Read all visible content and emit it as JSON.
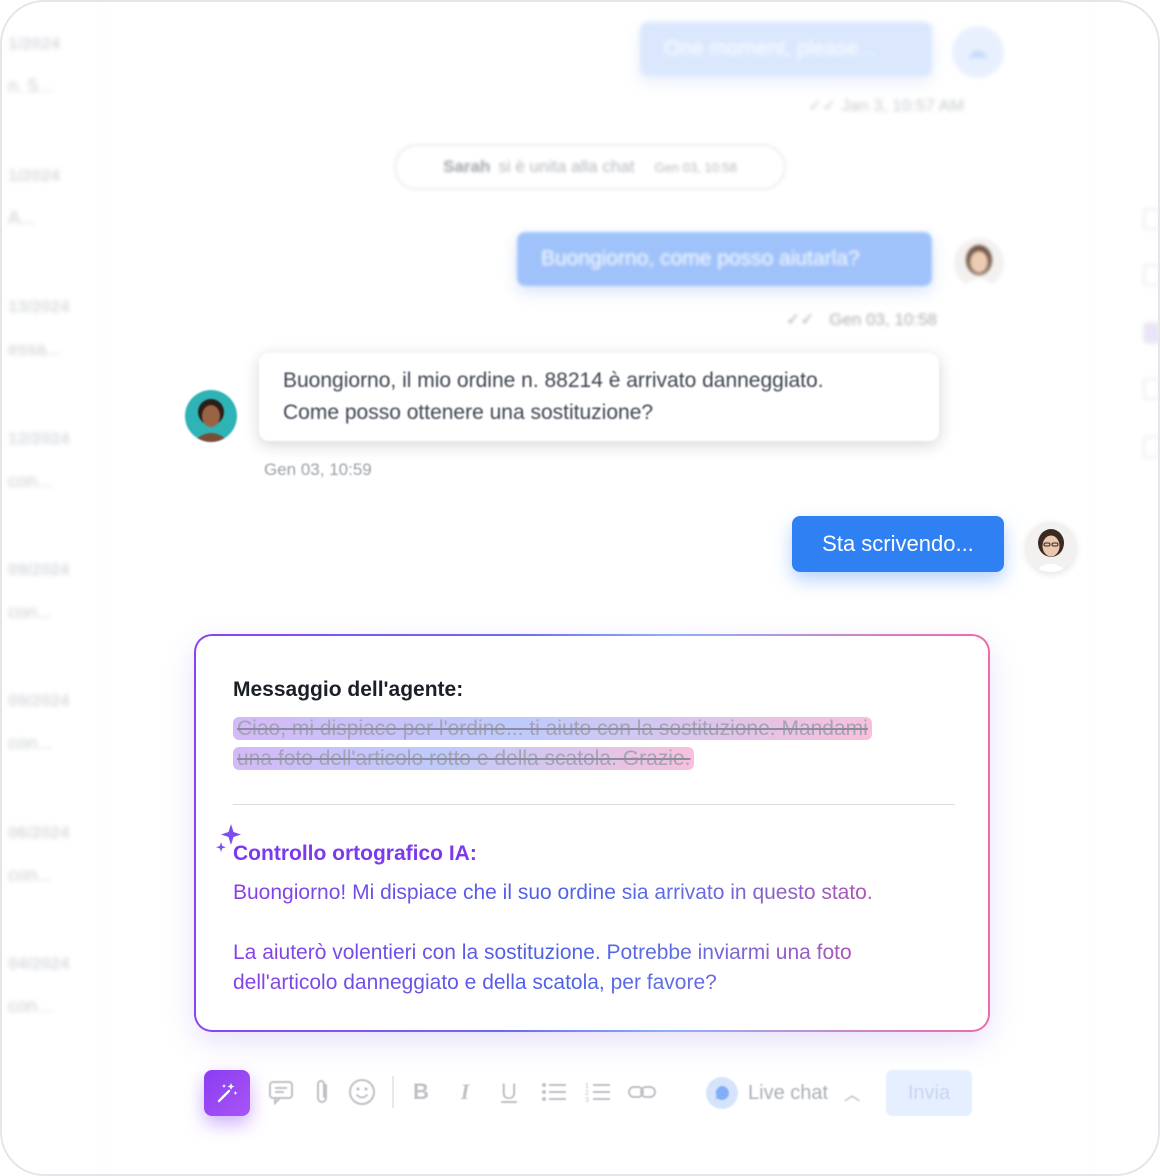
{
  "sidebar": {
    "conversations": [
      {
        "date": "1/2024",
        "preview": "n. 5..."
      },
      {
        "date": "1/2024",
        "preview": "A..."
      },
      {
        "date": "13/2024",
        "preview": "essa..."
      },
      {
        "date": "12/2024",
        "preview": "con..."
      },
      {
        "date": "09/2024",
        "preview": "con..."
      },
      {
        "date": "09/2024",
        "preview": "con..."
      },
      {
        "date": "06/2024",
        "preview": "con..."
      },
      {
        "date": "04/2024",
        "preview": "con..."
      }
    ]
  },
  "chat": {
    "top_message": {
      "text": "One moment, please...",
      "timestamp": "Jan 3, 10:57 AM"
    },
    "system_message": {
      "name": "Sarah",
      "text": "si è unita alla chat",
      "timestamp": "Gen 03, 10:58"
    },
    "agent_message": {
      "text": "Buongiorno, come posso aiutarla?",
      "timestamp": "Gen 03, 10:58"
    },
    "customer_message": {
      "line1": "Buongiorno, il mio ordine n. 88214 è arrivato danneggiato.",
      "line2": "Come posso ottenere una sostituzione?",
      "timestamp": "Gen 03, 10:59"
    },
    "typing_indicator": "Sta scrivendo..."
  },
  "ai_panel": {
    "agent_label": "Messaggio dell'agente:",
    "original_line1": "Ciao, mi dispiace per l'ordine... ti aiuto con la sostituzione. Mandami",
    "original_line2": "una foto dell'articolo rotto e della scatola. Grazie.",
    "ai_title": "Controllo ortografico IA:",
    "corrected_p1": "Buongiorno! Mi dispiace che il suo ordine sia arrivato in questo stato.",
    "corrected_p2_line1": "La aiuterò volentieri con la sostituzione. Potrebbe inviarmi una foto",
    "corrected_p2_line2": "dell'articolo danneggiato e della scatola, per favore?"
  },
  "composer": {
    "channel": "Live chat",
    "send_label": "Invia",
    "tools": [
      "magic-wand-icon",
      "comment-icon",
      "paperclip-icon",
      "emoji-icon",
      "bold-icon",
      "italic-icon",
      "underline-icon",
      "bullet-list-icon",
      "numbered-list-icon",
      "link-icon"
    ]
  },
  "colors": {
    "agent_bubble": "#8fb8fb",
    "typing_bubble": "#2f80f3",
    "ai_accent": "#7c3aed",
    "gradient_pink": "#f06aa8"
  }
}
